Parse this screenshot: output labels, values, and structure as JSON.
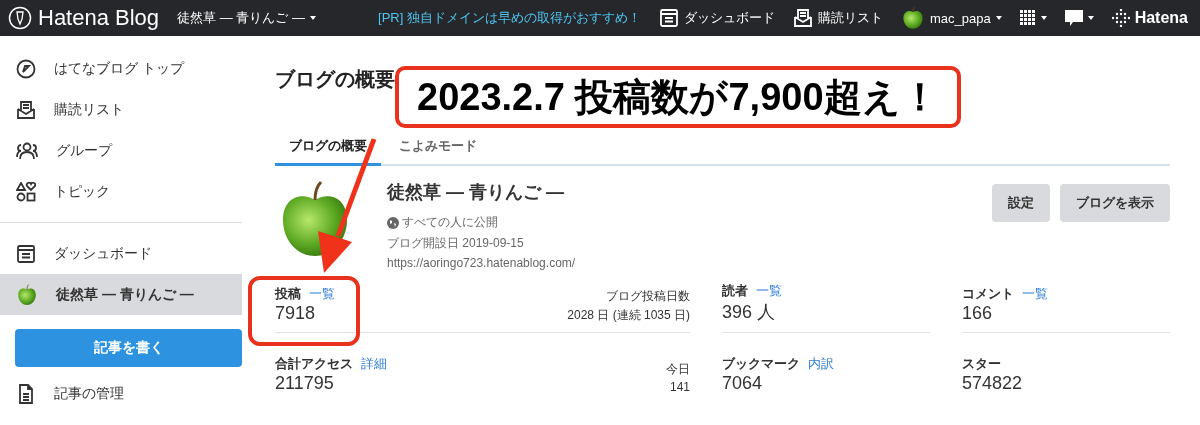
{
  "topbar": {
    "logo": "Hatena Blog",
    "blog_selector": "徒然草 — 青りんご —",
    "promo": "[PR] 独自ドメインは早めの取得がおすすめ！",
    "links": [
      {
        "kind": "dashboard",
        "label": "ダッシュボード"
      },
      {
        "kind": "subscriptions",
        "label": "購読リスト"
      }
    ],
    "user": "mac_papa",
    "brand": "Hatena"
  },
  "sidebar": {
    "sections": [
      {
        "items": [
          {
            "kind": "compass",
            "label": "はてなブログ トップ",
            "selected": false
          },
          {
            "kind": "subscriptions",
            "label": "購読リスト",
            "selected": false
          },
          {
            "kind": "group",
            "label": "グループ",
            "selected": false
          },
          {
            "kind": "topic",
            "label": "トピック",
            "selected": false
          }
        ]
      },
      {
        "items": [
          {
            "kind": "dashboard",
            "label": "ダッシュボード",
            "selected": false
          },
          {
            "kind": "blog",
            "label": "徒然草 — 青りんご —",
            "selected": true
          }
        ]
      }
    ],
    "write_button": "記事を書く",
    "after_items": [
      {
        "kind": "document",
        "label": "記事の管理",
        "selected": false
      }
    ]
  },
  "main": {
    "title": "ブログの概要",
    "tabs": [
      {
        "label": "ブログの概要",
        "selected": true
      },
      {
        "label": "こよみモード",
        "selected": false
      }
    ],
    "blog": {
      "name": "徒然草 — 青りんご —",
      "visibility": "すべての人に公開",
      "created": "ブログ開設日 2019-09-15",
      "url": "https://aoringo723.hatenablog.com/"
    },
    "buttons": [
      "設定",
      "ブログを表示"
    ],
    "stats": [
      {
        "label": "投稿",
        "link": "一覧",
        "value": "7918",
        "extra_label": "ブログ投稿日数",
        "extra_value": "2028 日 (連続 1035 日)"
      },
      {
        "label": "読者",
        "link": "一覧",
        "value": "396 人"
      },
      {
        "label": "コメント",
        "link": "一覧",
        "value": "166"
      },
      {
        "label": "合計アクセス",
        "link": "詳細",
        "value": "211795",
        "extra_label": "今日",
        "extra_value": "141"
      },
      {
        "label": "ブックマーク",
        "link": "内訳",
        "value": "7064"
      },
      {
        "label": "スター",
        "value": "574822"
      }
    ]
  },
  "annotation": {
    "banner": "2023.2.7 投稿数が7,900超え！"
  }
}
